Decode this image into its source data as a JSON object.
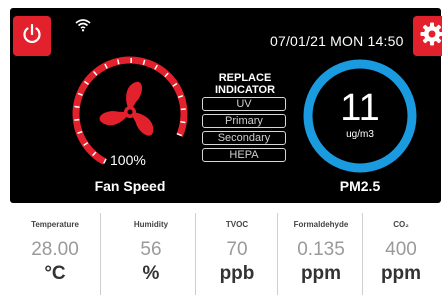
{
  "header": {
    "datetime": "07/01/21 MON 14:50",
    "power_icon": "power-icon",
    "settings_icon": "gear-icon",
    "wifi_icon": "wifi-icon"
  },
  "fan": {
    "percent_label": "100%",
    "speed_fraction": 1.0,
    "label": "Fan Speed",
    "icon": "fan-icon"
  },
  "replace_indicator": {
    "title_line1": "REPLACE",
    "title_line2": "INDICATOR",
    "filters": [
      "UV",
      "Primary",
      "Secondary",
      "HEPA"
    ]
  },
  "pm25": {
    "value": "11",
    "unit": "ug/m3",
    "label": "PM2.5"
  },
  "metrics": [
    {
      "label": "Temperature",
      "value": "28.00",
      "unit": "°C"
    },
    {
      "label": "Humidity",
      "value": "56",
      "unit": "%"
    },
    {
      "label": "TVOC",
      "value": "70",
      "unit": "ppb"
    },
    {
      "label": "Formaldehyde",
      "value": "0.135",
      "unit": "ppm"
    },
    {
      "label": "CO₂",
      "value": "400",
      "unit": "ppm"
    }
  ],
  "colors": {
    "accent_red": "#e3212c",
    "pm_ring_blue": "#1a9be0",
    "panel_black": "#000000"
  }
}
